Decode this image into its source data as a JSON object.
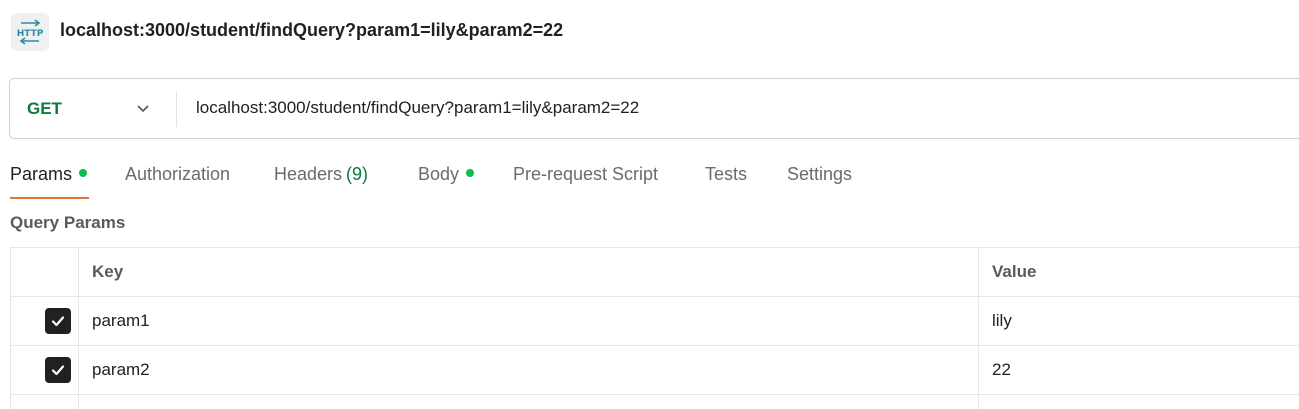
{
  "header": {
    "icon": "http-icon",
    "icon_text": "HTTP",
    "title": "localhost:3000/student/findQuery?param1=lily&param2=22"
  },
  "url_bar": {
    "method": "GET",
    "method_color": "#0b7a3b",
    "url": "localhost:3000/student/findQuery?param1=lily&param2=22"
  },
  "tabs": [
    {
      "label": "Params",
      "active": true,
      "dot": true
    },
    {
      "label": "Authorization",
      "active": false
    },
    {
      "label": "Headers",
      "count": "(9)",
      "active": false
    },
    {
      "label": "Body",
      "active": false,
      "dot": true
    },
    {
      "label": "Pre-request Script",
      "active": false
    },
    {
      "label": "Tests",
      "active": false
    },
    {
      "label": "Settings",
      "active": false
    }
  ],
  "query_params": {
    "title": "Query Params",
    "columns": [
      "Key",
      "Value"
    ],
    "rows": [
      {
        "checked": true,
        "key": "param1",
        "value": "lily"
      },
      {
        "checked": true,
        "key": "param2",
        "value": "22"
      }
    ]
  },
  "colors": {
    "accent": "#e8743b",
    "status_dot": "#0cbb52",
    "checkbox": "#212121"
  }
}
